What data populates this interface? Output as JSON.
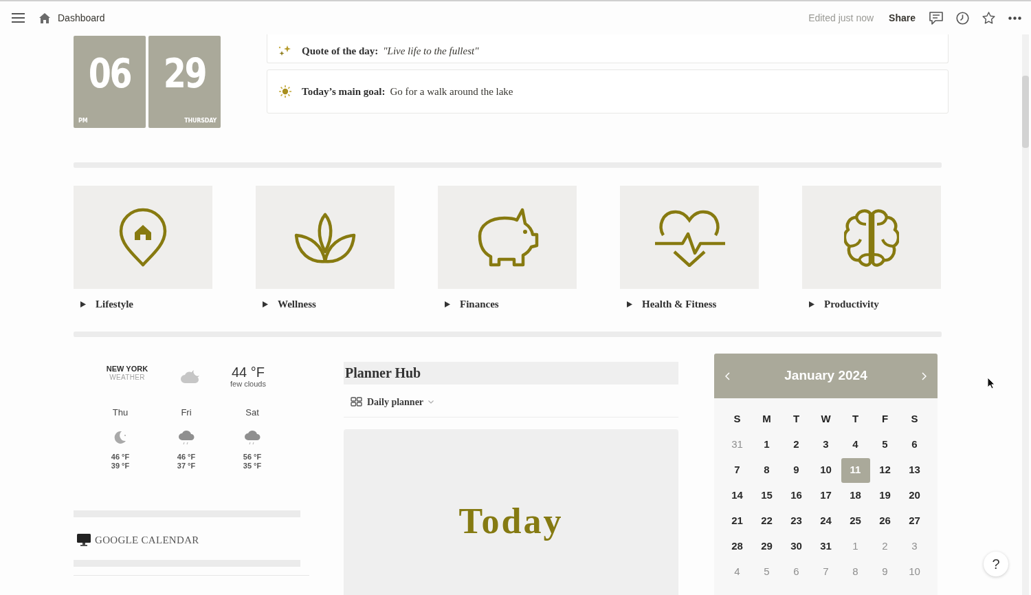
{
  "topbar": {
    "page_title": "Dashboard",
    "status": "Edited just now",
    "share": "Share"
  },
  "clock": [
    {
      "value": "06",
      "caption": "PM"
    },
    {
      "value": "29",
      "caption": "THURSDAY"
    }
  ],
  "callouts": [
    {
      "label": "Quote of the day:",
      "text": "\"Live life to the fullest\""
    },
    {
      "label": "Today’s main goal:",
      "text": "Go for a walk around the lake"
    }
  ],
  "categories": [
    {
      "label": "Lifestyle",
      "expanded": false
    },
    {
      "label": "Wellness",
      "expanded": false
    },
    {
      "label": "Finances",
      "expanded": false
    },
    {
      "label": "Health & Fitness",
      "expanded": false
    },
    {
      "label": "Productivity",
      "expanded": false
    }
  ],
  "weather": {
    "city": "NEW YORK",
    "subtitle": "WEATHER",
    "temperature": "44 °F",
    "condition": "few clouds",
    "forecast": [
      {
        "day": "Thu",
        "high": "46 °F",
        "low": "39 °F"
      },
      {
        "day": "Fri",
        "high": "46 °F",
        "low": "37 °F"
      },
      {
        "day": "Sat",
        "high": "56 °F",
        "low": "35 °F"
      }
    ]
  },
  "google_calendar": {
    "label": "GOOGLE CALENDAR"
  },
  "planner": {
    "title": "Planner Hub",
    "view": "Daily planner",
    "cover_text": "Today"
  },
  "calendar": {
    "month": "January 2024",
    "weekdays": [
      "S",
      "M",
      "T",
      "W",
      "T",
      "F",
      "S"
    ],
    "days": [
      {
        "label": "31",
        "outside_month": true,
        "selected": false
      },
      {
        "label": "1",
        "outside_month": false,
        "selected": false
      },
      {
        "label": "2",
        "outside_month": false,
        "selected": false
      },
      {
        "label": "3",
        "outside_month": false,
        "selected": false
      },
      {
        "label": "4",
        "outside_month": false,
        "selected": false
      },
      {
        "label": "5",
        "outside_month": false,
        "selected": false
      },
      {
        "label": "6",
        "outside_month": false,
        "selected": false
      },
      {
        "label": "7",
        "outside_month": false,
        "selected": false
      },
      {
        "label": "8",
        "outside_month": false,
        "selected": false
      },
      {
        "label": "9",
        "outside_month": false,
        "selected": false
      },
      {
        "label": "10",
        "outside_month": false,
        "selected": false
      },
      {
        "label": "11",
        "outside_month": false,
        "selected": true
      },
      {
        "label": "12",
        "outside_month": false,
        "selected": false
      },
      {
        "label": "13",
        "outside_month": false,
        "selected": false
      },
      {
        "label": "14",
        "outside_month": false,
        "selected": false
      },
      {
        "label": "15",
        "outside_month": false,
        "selected": false
      },
      {
        "label": "16",
        "outside_month": false,
        "selected": false
      },
      {
        "label": "17",
        "outside_month": false,
        "selected": false
      },
      {
        "label": "18",
        "outside_month": false,
        "selected": false
      },
      {
        "label": "19",
        "outside_month": false,
        "selected": false
      },
      {
        "label": "20",
        "outside_month": false,
        "selected": false
      },
      {
        "label": "21",
        "outside_month": false,
        "selected": false
      },
      {
        "label": "22",
        "outside_month": false,
        "selected": false
      },
      {
        "label": "23",
        "outside_month": false,
        "selected": false
      },
      {
        "label": "24",
        "outside_month": false,
        "selected": false
      },
      {
        "label": "25",
        "outside_month": false,
        "selected": false
      },
      {
        "label": "26",
        "outside_month": false,
        "selected": false
      },
      {
        "label": "27",
        "outside_month": false,
        "selected": false
      },
      {
        "label": "28",
        "outside_month": false,
        "selected": false
      },
      {
        "label": "29",
        "outside_month": false,
        "selected": false
      },
      {
        "label": "30",
        "outside_month": false,
        "selected": false
      },
      {
        "label": "31",
        "outside_month": false,
        "selected": false
      },
      {
        "label": "1",
        "outside_month": true,
        "selected": false
      },
      {
        "label": "2",
        "outside_month": true,
        "selected": false
      },
      {
        "label": "3",
        "outside_month": true,
        "selected": false
      },
      {
        "label": "4",
        "outside_month": true,
        "selected": false
      },
      {
        "label": "5",
        "outside_month": true,
        "selected": false
      },
      {
        "label": "6",
        "outside_month": true,
        "selected": false
      },
      {
        "label": "7",
        "outside_month": true,
        "selected": false
      },
      {
        "label": "8",
        "outside_month": true,
        "selected": false
      },
      {
        "label": "9",
        "outside_month": true,
        "selected": false
      },
      {
        "label": "10",
        "outside_month": true,
        "selected": false
      }
    ]
  },
  "help": "?"
}
